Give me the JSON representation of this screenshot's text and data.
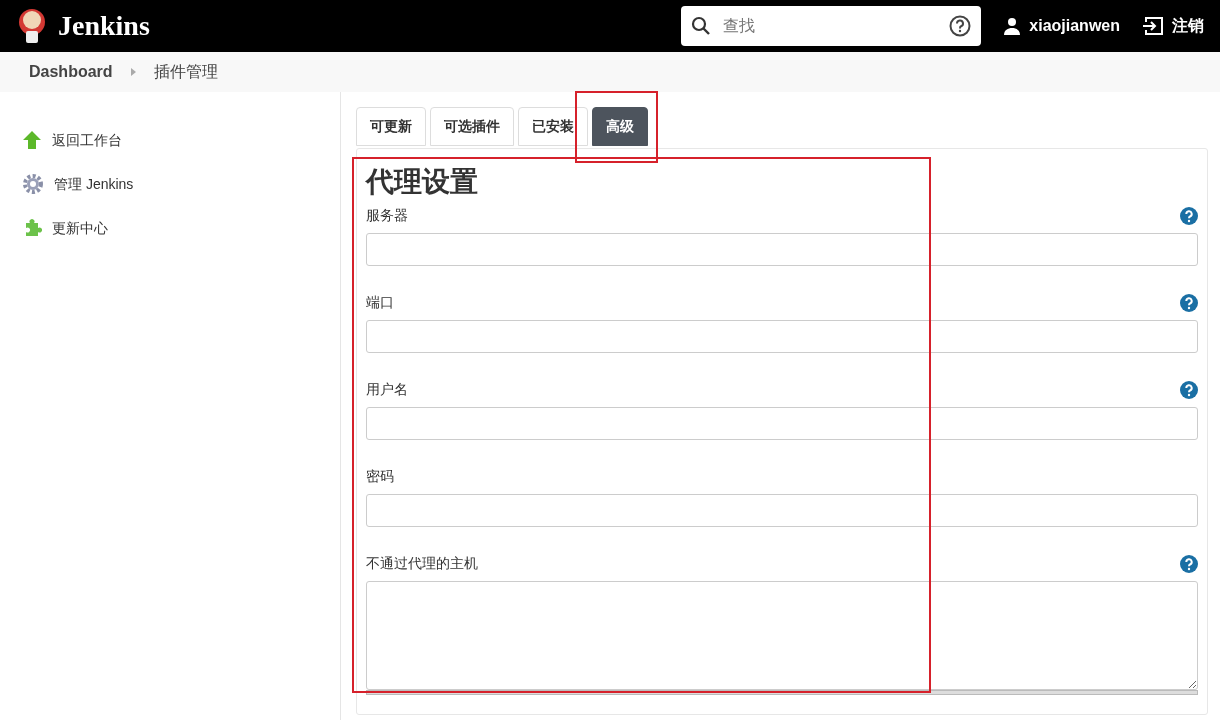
{
  "header": {
    "brand": "Jenkins",
    "search": {
      "placeholder": "查找"
    },
    "user": "xiaojianwen",
    "logout": "注销"
  },
  "breadcrumbs": [
    {
      "label": "Dashboard"
    },
    {
      "label": "插件管理"
    }
  ],
  "sidebar": {
    "items": [
      {
        "label": "返回工作台",
        "kind": "up"
      },
      {
        "label": "管理 Jenkins",
        "kind": "gear"
      },
      {
        "label": "更新中心",
        "kind": "puzzle"
      }
    ]
  },
  "tabs": [
    {
      "label": "可更新",
      "selected": false
    },
    {
      "label": "可选插件",
      "selected": false
    },
    {
      "label": "已安装",
      "selected": false
    },
    {
      "label": "高级",
      "selected": true
    }
  ],
  "section": {
    "title": "代理设置",
    "fields": [
      {
        "label": "服务器",
        "kind": "input",
        "help": true
      },
      {
        "label": "端口",
        "kind": "input",
        "help": true
      },
      {
        "label": "用户名",
        "kind": "input",
        "help": true
      },
      {
        "label": "密码",
        "kind": "input",
        "help": false
      },
      {
        "label": "不通过代理的主机",
        "kind": "textarea",
        "help": true
      }
    ]
  }
}
